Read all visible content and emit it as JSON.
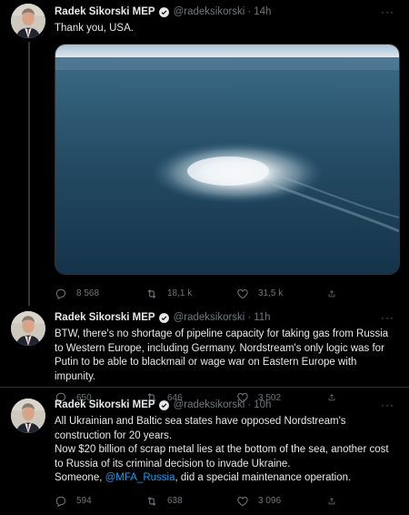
{
  "tweets": [
    {
      "name": "Radek Sikorski MEP",
      "handle": "@radeksikorski",
      "time": "14h",
      "text": "Thank you, USA.",
      "replies": "8 568",
      "retweets": "18,1 k",
      "likes": "31,5 k"
    },
    {
      "name": "Radek Sikorski MEP",
      "handle": "@radeksikorski",
      "time": "11h",
      "text": "BTW, there's no shortage of pipeline capacity for taking gas from Russia to Western Europe, including Germany. Nordstream's only logic was for Putin to be able to blackmail or wage war on Eastern Europe with impunity.",
      "replies": "650",
      "retweets": "646",
      "likes": "3 502"
    },
    {
      "name": "Radek Sikorski MEP",
      "handle": "@radeksikorski",
      "time": "10h",
      "text_before": "All Ukrainian and Baltic sea states have opposed Nordstream's construction for 20 years.\nNow $20 billion of scrap metal lies at the bottom of the sea, another cost to Russia of its criminal decision to invade Ukraine.\nSomeone, ",
      "mention": "@MFA_Russia",
      "text_after": ", did a special maintenance operation.",
      "replies": "594",
      "retweets": "638",
      "likes": "3 096"
    }
  ],
  "more_label": "···",
  "colors": {
    "accent": "#1d9bf0",
    "secondary": "#71767b",
    "background": "#000000"
  }
}
